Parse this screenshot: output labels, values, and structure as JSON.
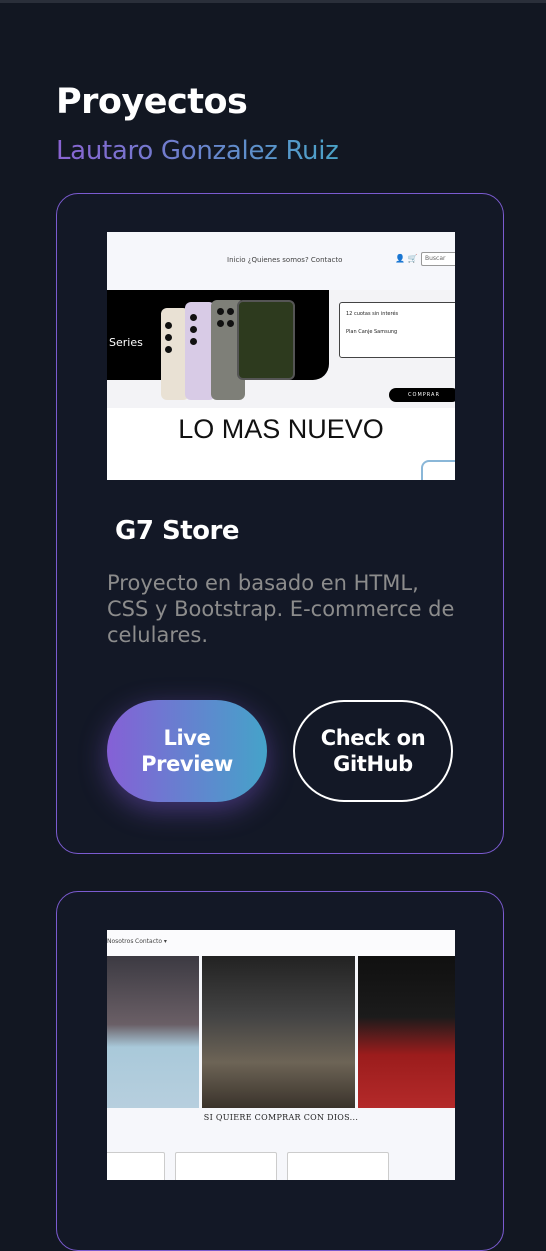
{
  "header": {
    "title": "Proyectos",
    "author": "Lautaro Gonzalez Ruiz"
  },
  "projects": [
    {
      "title": "G7 Store",
      "description": "Proyecto en basado en HTML, CSS y Bootstrap. E-commerce de celulares.",
      "live_label": "Live Preview",
      "github_label": "Check on GitHub",
      "preview": {
        "nav_links": "Inicio   ¿Quienes somos?   Contacto",
        "search_placeholder": "Buscar",
        "banner_text": "Series",
        "info_line1": "12 cuotas sin interés",
        "info_line2": "Plan Canje Samsung",
        "cta_label": "COMPRAR",
        "headline": "LO MAS NUEVO"
      }
    },
    {
      "preview": {
        "nav_links": [
          "Nosotros",
          "Contacto ▾"
        ],
        "headline": "SI QUIERE COMPRAR CON DIOS..."
      }
    }
  ],
  "colors": {
    "background": "#121722",
    "accent_purple": "#8560d6",
    "accent_blue": "#45a3c9",
    "card_border": "#7b5bd0",
    "muted_text": "#8c8c8c"
  }
}
